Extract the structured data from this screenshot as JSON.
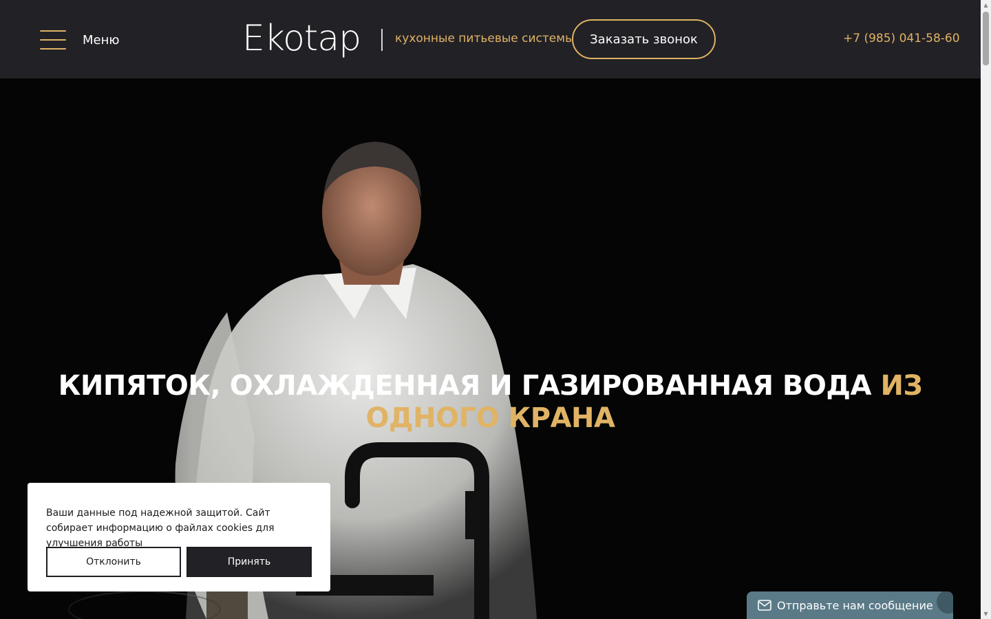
{
  "header": {
    "menu_label": "Меню",
    "logo_text": "Ekotap",
    "tagline": "кухонные питьевые системы",
    "callback_label": "Заказать звонок",
    "phone": "+7 (985) 041-58-60"
  },
  "hero": {
    "title_main": "КИПЯТОК, ОХЛАЖДЕННАЯ И ГАЗИРОВАННАЯ ВОДА ",
    "title_accent": "ИЗ ОДНОГО КРАНА"
  },
  "cookie": {
    "text": "Ваши данные под надежной защитой. Сайт собирает информацию о файлах cookies для улучшения работы",
    "decline_label": "Отклонить",
    "accept_label": "Принять"
  },
  "chat": {
    "label": "Отправьте нам сообщение",
    "icon": "envelope-icon"
  },
  "colors": {
    "accent": "#e0b365",
    "header_bg": "#222126",
    "chat_bg": "#5a7a87"
  }
}
